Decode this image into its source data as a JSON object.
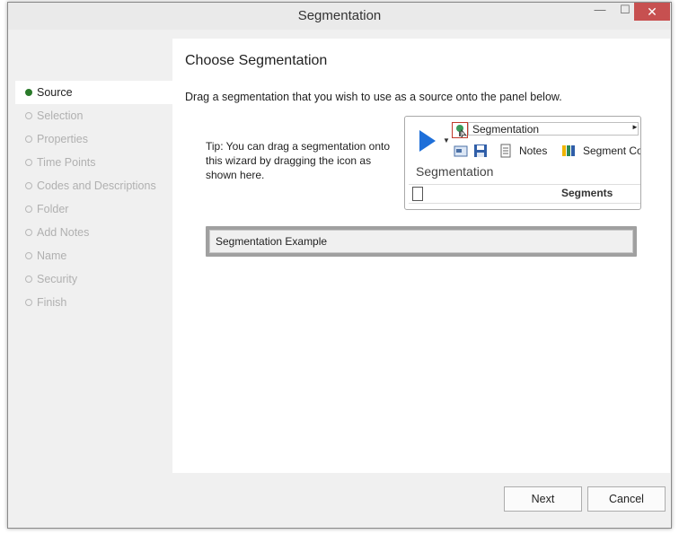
{
  "window": {
    "title": "Segmentation",
    "controls": {
      "minimize": "—",
      "maximize": "☐",
      "close": "✕"
    }
  },
  "sidebar": {
    "steps": [
      {
        "label": "Source",
        "active": true
      },
      {
        "label": "Selection",
        "active": false
      },
      {
        "label": "Properties",
        "active": false
      },
      {
        "label": "Time Points",
        "active": false
      },
      {
        "label": "Codes and Descriptions",
        "active": false
      },
      {
        "label": "Folder",
        "active": false
      },
      {
        "label": "Add Notes",
        "active": false
      },
      {
        "label": "Name",
        "active": false
      },
      {
        "label": "Security",
        "active": false
      },
      {
        "label": "Finish",
        "active": false
      }
    ]
  },
  "main": {
    "heading": "Choose Segmentation",
    "instruction": "Drag a segmentation that you wish to use as a source onto the panel below.",
    "tip": "Tip: You can drag a segmentation onto this wizard by dragging the icon as shown here.",
    "preview": {
      "field_value": "Segmentation",
      "notes_label": "Notes",
      "segment_co_label": "Segment Co",
      "title": "Segmentation",
      "column_header": "Segments"
    },
    "drop_panel_value": "Segmentation Example"
  },
  "footer": {
    "next_label": "Next",
    "cancel_label": "Cancel"
  },
  "colors": {
    "active_dot": "#2a7a2a",
    "close_button": "#c75050",
    "play_icon": "#1e6fd9"
  }
}
